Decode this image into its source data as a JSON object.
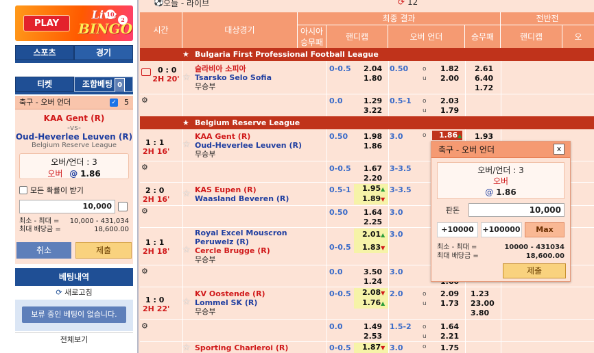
{
  "promo": {
    "play": "PLAY",
    "line1": "Live",
    "line2": "BINGO!",
    "ball1": "10",
    "ball2": "2"
  },
  "sidebar": {
    "tabs_top": [
      "스포츠",
      "경기"
    ],
    "tabs_ticket": [
      "티켓",
      "조합베팅"
    ],
    "combo_count": "0",
    "ticket": {
      "market": "축구 - 오버 언더",
      "count": "5",
      "home": "KAA Gent (R)",
      "vs": "-vs-",
      "away": "Oud-Heverlee Leuven (R)",
      "league": "Belgium Reserve League",
      "bet_line": "오버/언더 : 3",
      "pick": "오버",
      "at": "@",
      "odds": "1.86",
      "accept_all": "모든 확률이 받기",
      "amount": "10,000",
      "minmax_label": "최소 - 최대 =",
      "minmax_value": "10,000 - 431,034",
      "max_payout_label": "최대 배당금 =",
      "max_payout_value": "18,600.00",
      "cancel": "취소",
      "submit": "제출"
    },
    "history": {
      "title": "베팅내역",
      "refresh": "새로고침",
      "empty": "보류 중인 베팅이 없습니다.",
      "view_all": "전체보기"
    }
  },
  "main": {
    "section": "오늘 - 라이브",
    "live_count": "12",
    "headers": {
      "time": "시간",
      "match": "대상경기",
      "asia": "아시아 승무패",
      "final": "최종 결과",
      "first_half": "전반전",
      "handicap": "핸디캡",
      "over_under": "오버 언더",
      "result": "승무패",
      "handicap2": "핸디캡",
      "ou2": "오"
    },
    "leagues": [
      {
        "name": "Bulgaria First Professional Football League"
      },
      {
        "name": "Belgium Reserve League"
      }
    ],
    "matches": [
      {
        "score": "0 : 0",
        "time": "2H 20'",
        "home": "슬라비아 소피아",
        "away": "Tsarsko Selo Sofia",
        "draw": "무승부",
        "hc": "0-0.5",
        "hc_home": "2.04",
        "hc_away": "1.80",
        "ou": "0.50",
        "over": "1.82",
        "under": "2.00",
        "r1": "2.61",
        "r2": "6.40",
        "r3": "1.72",
        "sub": {
          "hc": "0.0",
          "hc_home": "1.29",
          "hc_away": "3.22",
          "ou": "0.5-1",
          "over": "2.03",
          "under": "1.79"
        }
      },
      {
        "score": "1 : 1",
        "time": "2H 16'",
        "home": "KAA Gent (R)",
        "away": "Oud-Heverlee Leuven (R)",
        "draw": "무승부",
        "hc": "0.50",
        "hc_home": "1.98",
        "hc_away": "1.86",
        "ou": "3.0",
        "over": "1.86",
        "under": "",
        "r1": "1.93",
        "sub": {
          "hc": "0-0.5",
          "hc_home": "1.67",
          "hc_away": "2.20",
          "ou": "3-3.5"
        }
      },
      {
        "score": "2 : 0",
        "time": "2H 16'",
        "home": "KAS Eupen (R)",
        "away": "Waasland Beveren (R)",
        "hc": "0.5-1",
        "hc_home": "1.95",
        "hc_away": "1.89",
        "ou": "3-3.5",
        "sub": {
          "hc": "0.50",
          "hc_home": "1.64",
          "hc_away": "2.25",
          "ou": "3.0"
        }
      },
      {
        "score": "1 : 1",
        "time": "2H 18'",
        "home": "Royal Excel Mouscron",
        "home2": "Peruwelz (R)",
        "away": "Cercle Brugge (R)",
        "draw": "무승부",
        "hc": "0-0.5",
        "hc_home": "2.01",
        "hc_away": "1.83",
        "ou": "3.0",
        "sub": {
          "hc": "0.0",
          "hc_home": "3.50",
          "hc_away": "1.24",
          "ou": "3.0",
          "u_val": "1.60"
        }
      },
      {
        "score": "1 : 0",
        "time": "2H 22'",
        "home": "KV Oostende (R)",
        "away": "Lommel SK (R)",
        "draw": "무승부",
        "hc": "0-0.5",
        "hc_home": "2.08",
        "hc_away": "1.76",
        "ou": "2.0",
        "over": "2.09",
        "under": "1.73",
        "r1": "1.23",
        "r2": "23.00",
        "r3": "3.80",
        "sub": {
          "hc": "0.0",
          "hc_home": "1.49",
          "hc_away": "2.53",
          "ou": "1.5-2",
          "over": "1.64",
          "under": "2.21"
        }
      },
      {
        "home": "Sporting Charleroi (R)",
        "hc": "0-0.5",
        "hc_home": "1.87",
        "ou": "3.0",
        "over": "1.75"
      }
    ],
    "ou_o": "o",
    "ou_u": "u"
  },
  "popup": {
    "title": "축구 - 오버 언더",
    "close": "x",
    "bet_line": "오버/언더 : 3",
    "pick": "오버",
    "at": "@",
    "odds": "1.86",
    "amount_label": "판돈",
    "amount": "10,000",
    "q1": "+10000",
    "q2": "+100000",
    "qmax": "Max",
    "minmax_label": "최소 - 최대 =",
    "minmax_value": "10000 - 431034",
    "payout_label": "최대 배당금 =",
    "payout_value": "18,600.00",
    "submit": "제출"
  },
  "colors": {
    "header": "#f59a72",
    "league": "#c0331b",
    "navy": "#1f4f95",
    "bg": "#fde3d6"
  }
}
